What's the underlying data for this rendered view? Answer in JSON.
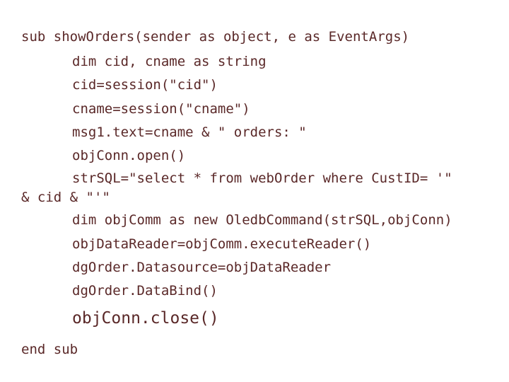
{
  "slide": {
    "background_color": "#ffffff",
    "text_color": "#5a2828",
    "language": "VB.NET",
    "code": {
      "line_sub": "sub showOrders(sender as object, e as EventArgs)",
      "line_dim_vars": "dim cid, cname as string",
      "line_cid_assign": "cid=session(\"cid\")",
      "line_cname_assign": "cname=session(\"cname\")",
      "line_msg_text": "msg1.text=cname & \" orders: \"",
      "line_conn_open": "objConn.open()",
      "line_strsql": "strSQL=\"select * from webOrder where CustID= '\"",
      "line_strsql_continued": "& cid & \"'\"",
      "line_dim_command": "dim objComm as new OledbCommand(strSQL,objConn)",
      "line_datareader": "objDataReader=objComm.executeReader()",
      "line_datasource": "dgOrder.Datasource=objDataReader",
      "line_databind": "dgOrder.DataBind()",
      "line_conn_close": "objConn.close()",
      "line_end_sub": "end sub"
    }
  }
}
